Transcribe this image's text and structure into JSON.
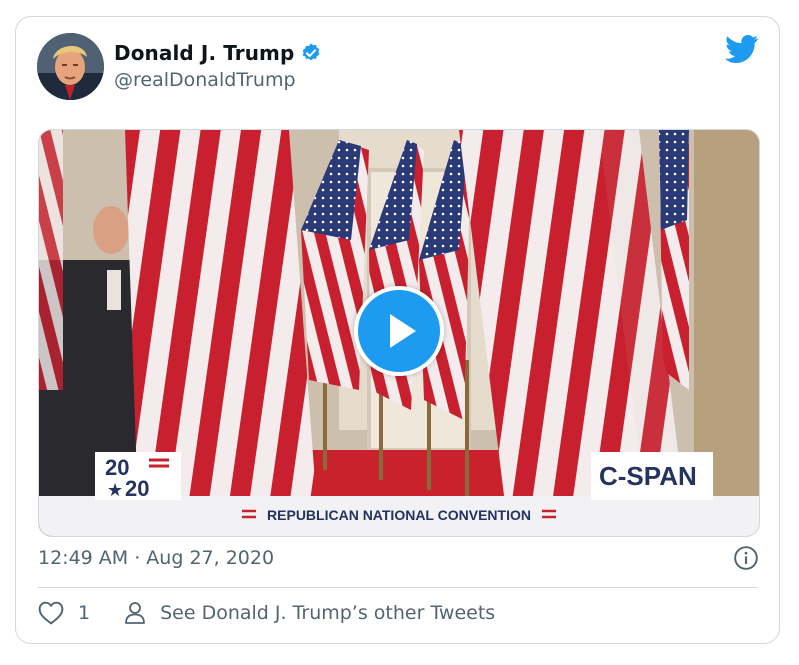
{
  "tweet": {
    "author_name": "Donald J. Trump",
    "handle": "@realDonaldTrump",
    "verified": true,
    "timestamp": "12:49 AM · Aug 27, 2020",
    "like_count": "1",
    "see_other_label": "See Donald J. Trump’s other Tweets"
  },
  "video": {
    "year_badge_top": "20",
    "year_badge_bottom": "20",
    "network_badge": "C-SPAN",
    "banner_text": "REPUBLICAN NATIONAL CONVENTION"
  },
  "colors": {
    "accent": "#1d9bf0",
    "text_primary": "#0f1419",
    "text_secondary": "#536471",
    "border": "#cfd9de",
    "flag_red": "#c8202f",
    "badge_navy": "#24335f"
  },
  "icons": {
    "brand": "twitter-bird-icon",
    "verified": "verified-badge-icon",
    "play": "play-icon",
    "info": "info-icon",
    "like": "heart-icon",
    "profile": "person-icon"
  }
}
